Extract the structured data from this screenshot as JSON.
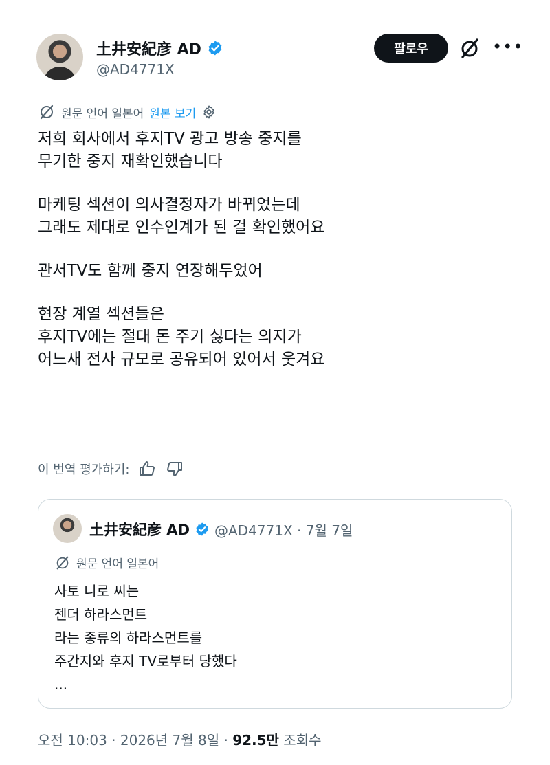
{
  "author": {
    "name": "土井安紀彦 AD",
    "handle": "@AD4771X"
  },
  "header": {
    "follow_label": "팔로우"
  },
  "translation": {
    "original_language": "원문 언어 일본어",
    "show_original_link": "원본 보기"
  },
  "tweet": {
    "paragraphs": [
      [
        "저희 회사에서 후지TV 광고 방송 중지를",
        "무기한 중지 재확인했습니다"
      ],
      [
        "마케팅 섹션이 의사결정자가 바뀌었는데",
        "그래도 제대로 인수인계가 된 걸 확인했어요"
      ],
      [
        "관서TV도 함께 중지 연장해두었어"
      ],
      [
        "현장 계열 섹션들은",
        "후지TV에는 절대 돈 주기 싫다는 의지가",
        "어느새 전사 규모로 공유되어 있어서 웃겨요"
      ]
    ]
  },
  "rate": {
    "label": "이 번역 평가하기:"
  },
  "quote": {
    "name": "土井安紀彦 AD",
    "meta": "@AD4771X · 7월 7일",
    "translation_note": "원문 언어 일본어",
    "lines": [
      "사토 니로 씨는",
      "젠더 하라스먼트",
      "라는 종류의 하라스먼트를",
      "주간지와 후지 TV로부터 당했다",
      "..."
    ]
  },
  "footer": {
    "time": "오전 10:03 · 2026년 7월 8일 · ",
    "views": "92.5만",
    "views_label": " 조회수"
  },
  "icons": {
    "verified": "verified-badge-icon",
    "grok": "grok-icon",
    "more": "more-icon",
    "translate": "translate-icon",
    "gear": "gear-icon",
    "thumbs_up": "thumbs-up-icon",
    "thumbs_down": "thumbs-down-icon"
  },
  "colors": {
    "accent": "#1d9bf0",
    "text": "#0f1419",
    "secondary": "#536471",
    "border": "#cfd9de"
  }
}
